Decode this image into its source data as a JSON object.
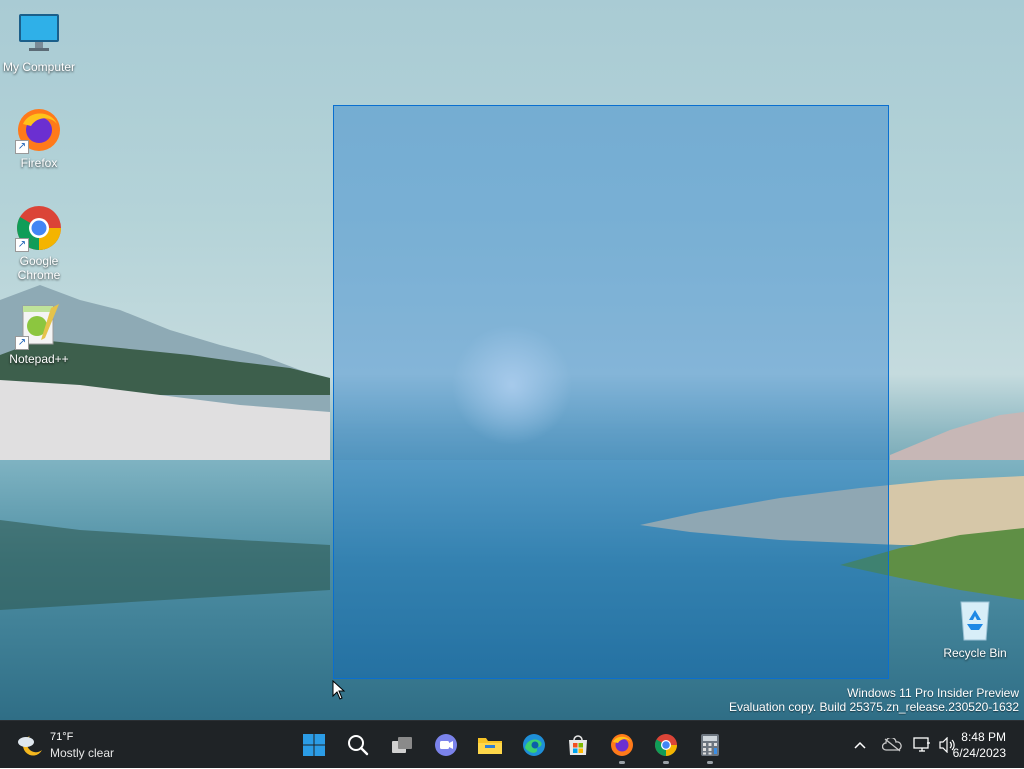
{
  "desktop": {
    "icons": [
      {
        "label": "My Computer",
        "icon": "monitor-icon"
      },
      {
        "label": "Firefox",
        "icon": "firefox-icon"
      },
      {
        "label": "Google Chrome",
        "icon": "chrome-icon"
      },
      {
        "label": "Notepad++",
        "icon": "notepad-plus-plus-icon"
      },
      {
        "label": "Recycle Bin",
        "icon": "recycle-bin-icon"
      }
    ],
    "watermark": {
      "line1": "Windows 11 Pro Insider Preview",
      "line2": "Evaluation copy. Build 25375.zn_release.230520-1632"
    }
  },
  "taskbar": {
    "weather": {
      "temp": "71°F",
      "condition": "Mostly clear",
      "icon": "moon-cloud-icon"
    },
    "apps": [
      {
        "name": "Start",
        "icon": "windows-start-icon",
        "running": false
      },
      {
        "name": "Search",
        "icon": "search-icon",
        "running": false
      },
      {
        "name": "Task View",
        "icon": "task-view-icon",
        "running": false
      },
      {
        "name": "Chat",
        "icon": "teams-chat-icon",
        "running": false
      },
      {
        "name": "File Explorer",
        "icon": "folder-icon",
        "running": false
      },
      {
        "name": "Microsoft Edge",
        "icon": "edge-icon",
        "running": false
      },
      {
        "name": "Microsoft Store",
        "icon": "store-icon",
        "running": false
      },
      {
        "name": "Firefox",
        "icon": "firefox-icon",
        "running": true
      },
      {
        "name": "Google Chrome",
        "icon": "chrome-icon",
        "running": true
      },
      {
        "name": "Calculator",
        "icon": "calculator-icon",
        "running": true
      }
    ],
    "tray": {
      "icons": [
        "chevron-up-icon",
        "onedrive-offline-icon",
        "network-icon",
        "volume-icon"
      ],
      "time": "8:48 PM",
      "date": "6/24/2023"
    }
  },
  "colors": {
    "selection": "#0066cc",
    "taskbar": "#1f2326"
  }
}
